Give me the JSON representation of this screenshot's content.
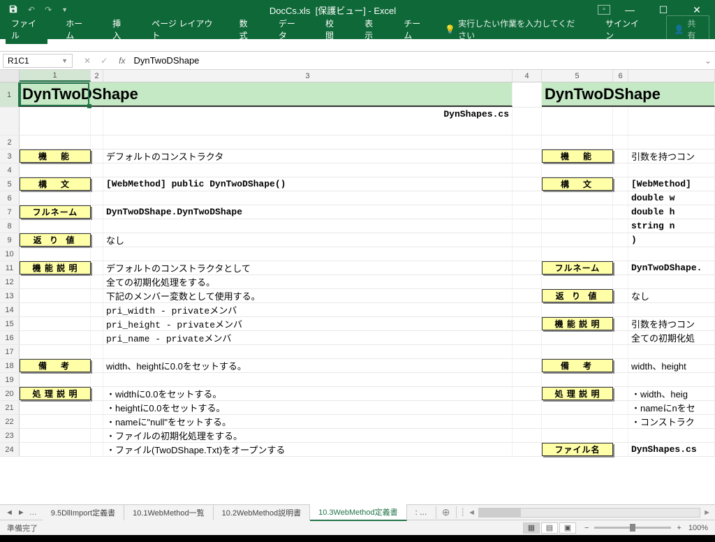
{
  "title": {
    "filename": "DocCs.xls",
    "mode": "[保護ビュー]",
    "app": "Excel"
  },
  "qat": {
    "undo_tip": "↶",
    "redo_tip": "↷"
  },
  "ribbon": {
    "file": "ファイル",
    "home": "ホーム",
    "insert": "挿入",
    "layout": "ページ レイアウト",
    "formulas": "数式",
    "data": "データ",
    "review": "校閲",
    "view": "表示",
    "team": "チーム",
    "tellme": "実行したい作業を入力してください",
    "signin": "サインイン",
    "share": "共有"
  },
  "namebox": "R1C1",
  "formula": "DynTwoDShape",
  "cols": [
    "1",
    "2",
    "3",
    "4",
    "5",
    "6"
  ],
  "sheet": {
    "title1": "DynTwoDShape",
    "title2": "DynTwoDShape",
    "filename_cs": "DynShapes.cs",
    "labels": {
      "func": "機　能",
      "syntax": "構　文",
      "fullname": "フルネーム",
      "return": "返 り 値",
      "funcdesc": "機 能 説 明",
      "remark": "備　考",
      "procdesc": "処 理 説 明",
      "file": "ファイル名"
    },
    "left": {
      "func": "デフォルトのコンストラクタ",
      "syntax": "[WebMethod] public DynTwoDShape()",
      "fullname": "DynTwoDShape.DynTwoDShape",
      "return": "なし",
      "desc1": "デフォルトのコンストラクタとして",
      "desc2": "全ての初期化処理をする。",
      "desc3": "下記のメンバー変数として使用する。",
      "desc4": " pri_width - privateメンバ",
      "desc5": " pri_height - privateメンバ",
      "desc6": " pri_name - privateメンバ",
      "remark": "width、heightに0.0をセットする。",
      "proc1": "・widthに0.0をセットする。",
      "proc2": "・heightに0.0をセットする。",
      "proc3": "・nameに\"null\"をセットする。",
      "proc4": "・ファイルの初期化処理をする。",
      "proc5": "・ファイル(TwoDShape.Txt)をオープンする"
    },
    "right": {
      "func": "引数を持つコン",
      "syntax": "[WebMethod]",
      "s2": "  double w",
      "s3": "  double h",
      "s4": "  string n",
      "s5": ")",
      "fullname": "DynTwoDShape.",
      "return": "なし",
      "desc1": "引数を持つコン",
      "desc2": "全ての初期化処",
      "remark": "width、height",
      "proc1": "・width、heig",
      "proc2": "・nameにnをセ",
      "proc3": "・コンストラク",
      "file": "DynShapes.cs"
    }
  },
  "tabs": {
    "nav_dots": "…",
    "t1": "9.5DllImport定義書",
    "t2": "10.1WebMethod一覧",
    "t3": "10.2WebMethod説明書",
    "t4": "10.3WebMethod定義書",
    "more": ": …"
  },
  "status": {
    "ready": "準備完了",
    "zoom": "100%"
  }
}
